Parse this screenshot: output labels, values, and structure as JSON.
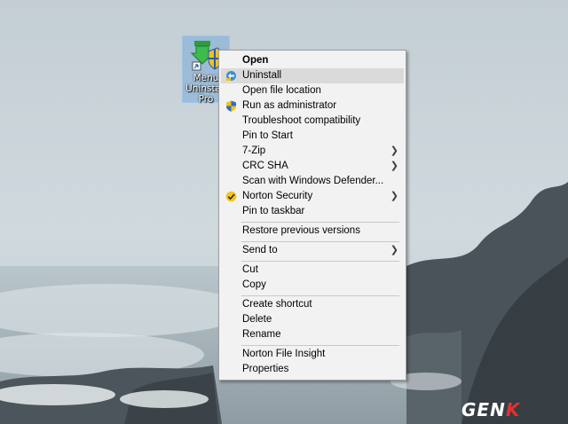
{
  "desktop_icon": {
    "label": "Menu Uninstall Pro",
    "label_lines": [
      "Menu",
      "Uninstall",
      "Pro"
    ],
    "icon": "menu-uninstall-pro-app-icon"
  },
  "context_menu": {
    "items": [
      {
        "label": "Open",
        "bold": true
      },
      {
        "label": "Uninstall",
        "icon": "uninstall-icon",
        "highlighted": true
      },
      {
        "label": "Open file location"
      },
      {
        "label": "Run as administrator",
        "icon": "uac-shield-icon"
      },
      {
        "label": "Troubleshoot compatibility"
      },
      {
        "label": "Pin to Start"
      },
      {
        "label": "7-Zip",
        "submenu": true
      },
      {
        "label": "CRC SHA",
        "submenu": true
      },
      {
        "label": "Scan with Windows Defender..."
      },
      {
        "label": "Norton Security",
        "icon": "norton-check-icon",
        "submenu": true
      },
      {
        "label": "Pin to taskbar"
      },
      {
        "label": "Restore previous versions"
      },
      {
        "label": "Send to",
        "submenu": true
      },
      {
        "label": "Cut"
      },
      {
        "label": "Copy"
      },
      {
        "label": "Create shortcut"
      },
      {
        "label": "Delete"
      },
      {
        "label": "Rename"
      },
      {
        "label": "Norton File Insight"
      },
      {
        "label": "Properties"
      }
    ],
    "highlight_color": "#dadada",
    "background_color": "#f2f2f2"
  },
  "watermark": {
    "main": "GEN",
    "accent": "K",
    "accent_color": "#e53030"
  }
}
